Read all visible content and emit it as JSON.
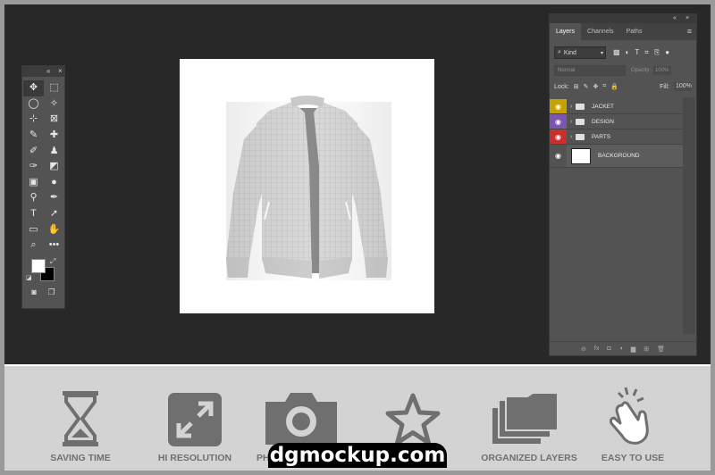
{
  "toolbar": {
    "collapse_label": "«",
    "close_label": "×",
    "tools": [
      {
        "icon": "move-icon",
        "glyph": "✥"
      },
      {
        "icon": "marquee-icon",
        "glyph": "⬚"
      },
      {
        "icon": "lasso-icon",
        "glyph": "◯"
      },
      {
        "icon": "magic-wand-icon",
        "glyph": "✧"
      },
      {
        "icon": "crop-icon",
        "glyph": "⊹"
      },
      {
        "icon": "frame-icon",
        "glyph": "⊠"
      },
      {
        "icon": "eyedropper-icon",
        "glyph": "✎"
      },
      {
        "icon": "healing-brush-icon",
        "glyph": "✚"
      },
      {
        "icon": "brush-icon",
        "glyph": "✐"
      },
      {
        "icon": "stamp-icon",
        "glyph": "♟"
      },
      {
        "icon": "history-brush-icon",
        "glyph": "✑"
      },
      {
        "icon": "eraser-icon",
        "glyph": "◩"
      },
      {
        "icon": "gradient-icon",
        "glyph": "▣"
      },
      {
        "icon": "blur-icon",
        "glyph": "●"
      },
      {
        "icon": "dodge-icon",
        "glyph": "⚲"
      },
      {
        "icon": "pen-icon",
        "glyph": "✒"
      },
      {
        "icon": "type-icon",
        "glyph": "T"
      },
      {
        "icon": "path-selection-icon",
        "glyph": "➚"
      },
      {
        "icon": "rectangle-icon",
        "glyph": "▭"
      },
      {
        "icon": "hand-icon",
        "glyph": "✋"
      },
      {
        "icon": "zoom-icon",
        "glyph": "⌕"
      },
      {
        "icon": "more-tools-icon",
        "glyph": "•••"
      }
    ],
    "foreground_color": "#ffffff",
    "background_color": "#000000",
    "bottom": [
      {
        "icon": "quick-mask-icon",
        "glyph": "◙"
      },
      {
        "icon": "screen-mode-icon",
        "glyph": "❐"
      }
    ]
  },
  "layers_panel": {
    "collapse_label": "«",
    "close_label": "×",
    "tabs": [
      {
        "label": "Layers",
        "active": true
      },
      {
        "label": "Channels",
        "active": false
      },
      {
        "label": "Paths",
        "active": false
      }
    ],
    "menu_glyph": "≡",
    "filter_label": "Kind",
    "filter_icons": [
      "▩",
      "◐",
      "T",
      "⌗",
      "⎘",
      "●"
    ],
    "blend_mode": "Normal",
    "opacity_label": "Opacity:",
    "opacity_value": "100%",
    "lock_label": "Lock:",
    "lock_icons": [
      "⊞",
      "✎",
      "✥",
      "⌗",
      "🔒"
    ],
    "fill_label": "Fill:",
    "fill_value": "100%",
    "layers": [
      {
        "name": "JACKET",
        "type": "group",
        "color": "#c6a300"
      },
      {
        "name": "DESIGN",
        "type": "group",
        "color": "#7b55b0"
      },
      {
        "name": "PARTS",
        "type": "group",
        "color": "#c8302c"
      },
      {
        "name": "BACKGROUND",
        "type": "layer",
        "color": ""
      }
    ],
    "bottom_icons": [
      "⊖",
      "fx",
      "◘",
      "◑",
      "▆",
      "⊞",
      "🗑"
    ]
  },
  "features": [
    {
      "label": "SAVING TIME",
      "icon": "hourglass-icon"
    },
    {
      "label": "HI RESOLUTION",
      "icon": "expand-arrows-icon"
    },
    {
      "label": "PHO",
      "icon": "camera-icon"
    },
    {
      "label": "AL",
      "icon": "star-icon"
    },
    {
      "label": "ORGANIZED LAYERS",
      "icon": "folder-stack-icon"
    },
    {
      "label": "EASY TO USE",
      "icon": "click-hand-icon"
    }
  ],
  "watermark": "dgmockup.com"
}
